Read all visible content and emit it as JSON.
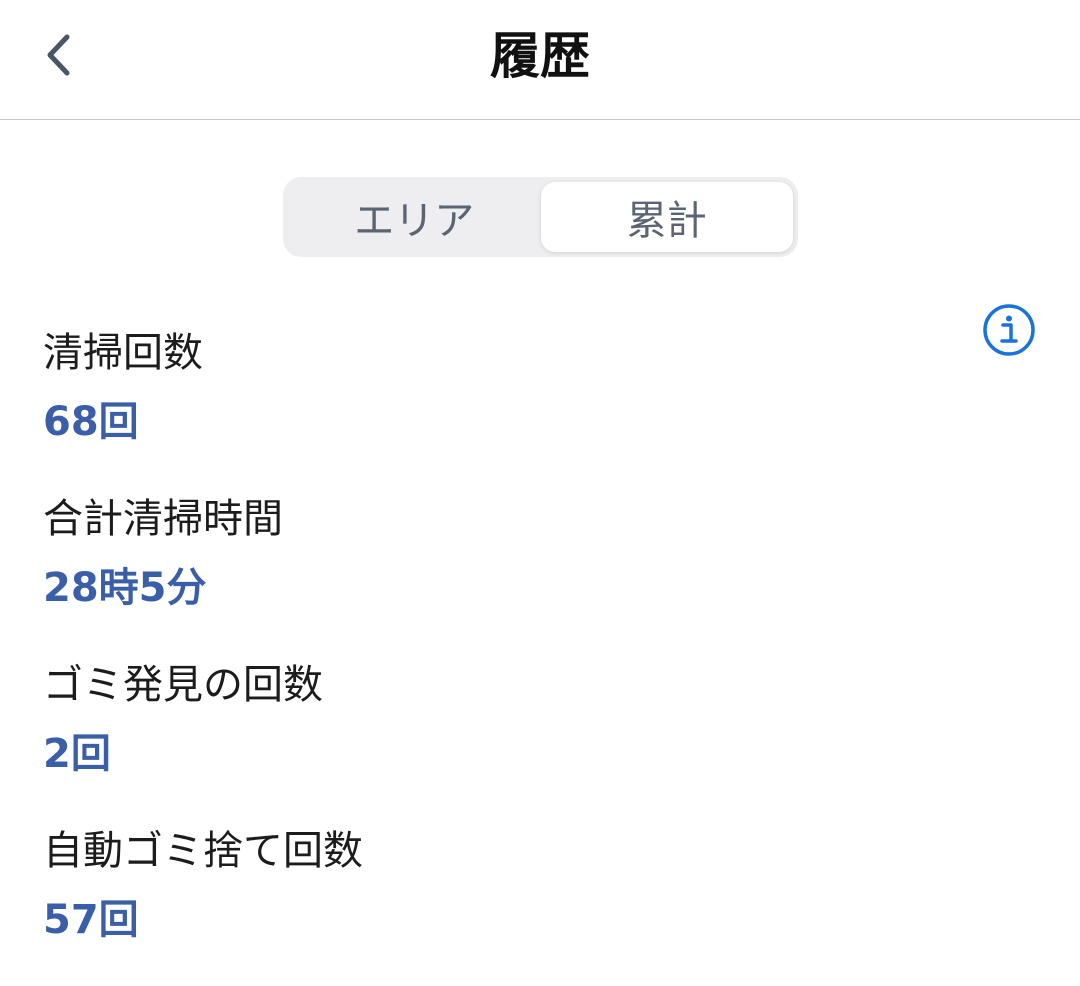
{
  "header": {
    "title": "履歴",
    "back_icon": "chevron-left-icon"
  },
  "tabs": [
    {
      "label": "エリア",
      "selected": false
    },
    {
      "label": "累計",
      "selected": true
    }
  ],
  "info_icon": "info-circle-icon",
  "colors": {
    "accent": "#1a73d9",
    "value": "#3a5fa8",
    "tab_text": "#5b6473",
    "divider": "#c8c8cc",
    "segment_bg": "#eeeef0"
  },
  "stats": [
    {
      "label": "清掃回数",
      "value": "68回"
    },
    {
      "label": "合計清掃時間",
      "value": "28時5分"
    },
    {
      "label": "ゴミ発見の回数",
      "value": "2回"
    },
    {
      "label": "自動ゴミ捨て回数",
      "value": "57回"
    }
  ]
}
